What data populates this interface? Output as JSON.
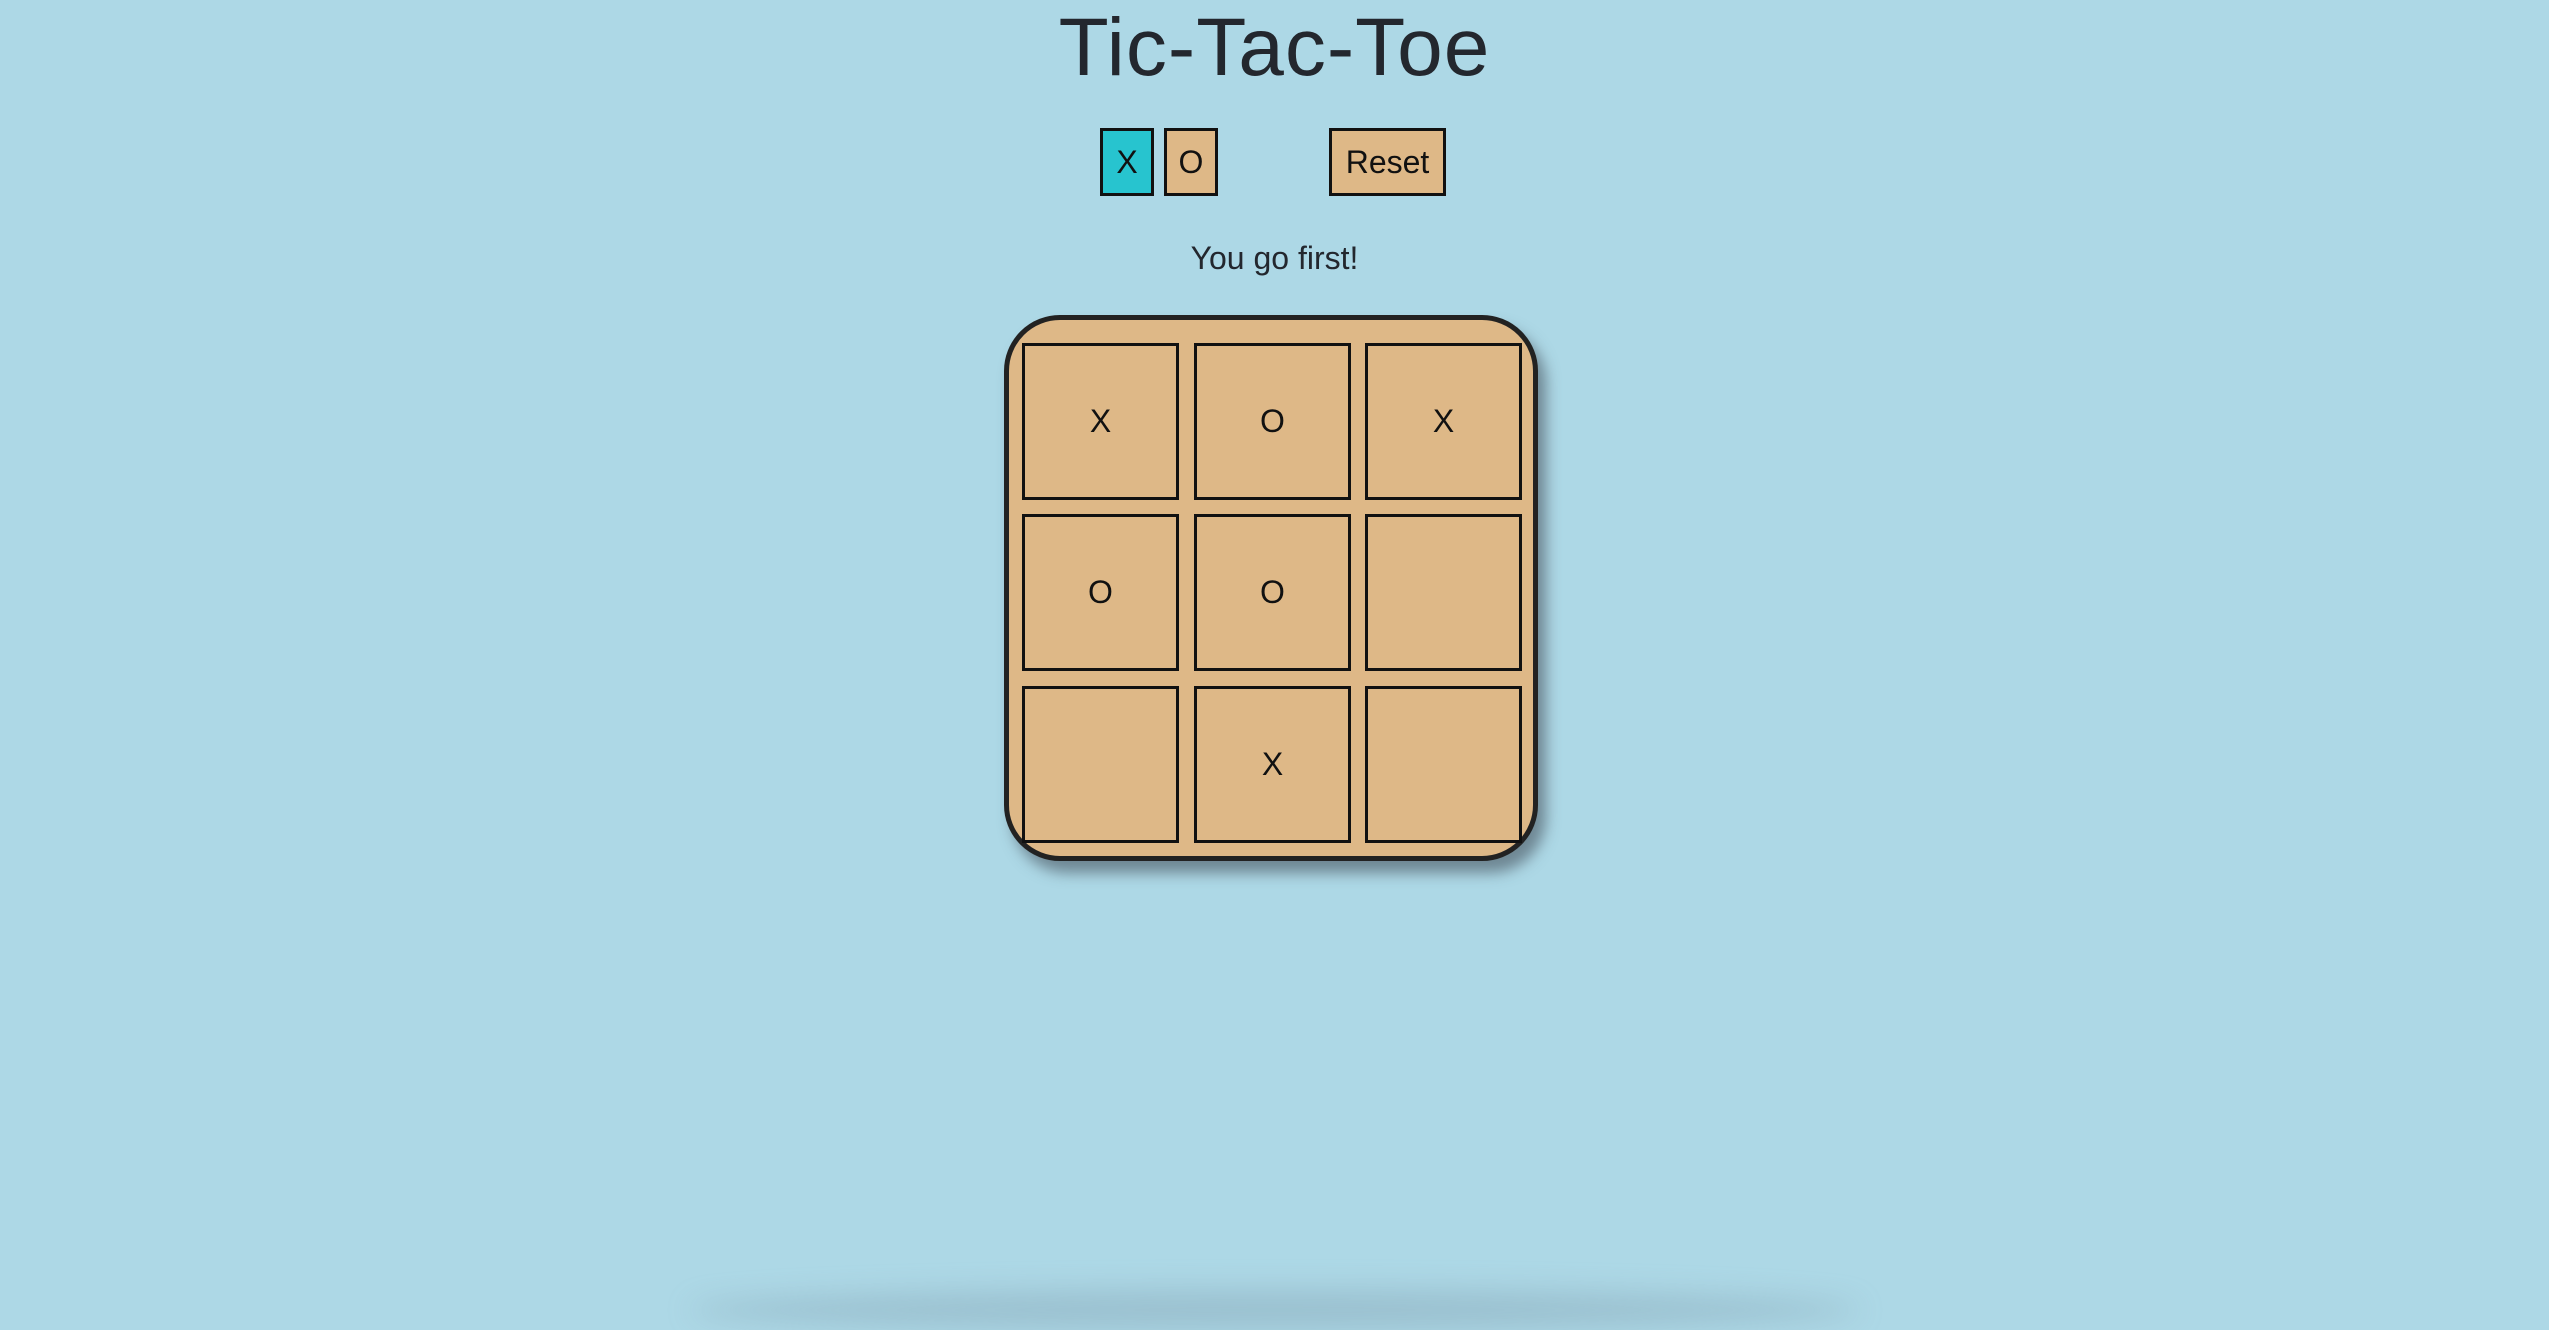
{
  "header": {
    "title": "Tic-Tac-Toe"
  },
  "controls": {
    "symbol_x_label": "X",
    "symbol_o_label": "O",
    "selected_symbol": "X",
    "reset_label": "Reset"
  },
  "status": {
    "message": "You go first!"
  },
  "board": {
    "cells": [
      "X",
      "O",
      "X",
      "O",
      "O",
      "",
      "",
      "X",
      ""
    ]
  },
  "colors": {
    "background": "#add8e6",
    "board": "#deb887",
    "selected_symbol": "#27c4cf",
    "text": "#23272e"
  }
}
